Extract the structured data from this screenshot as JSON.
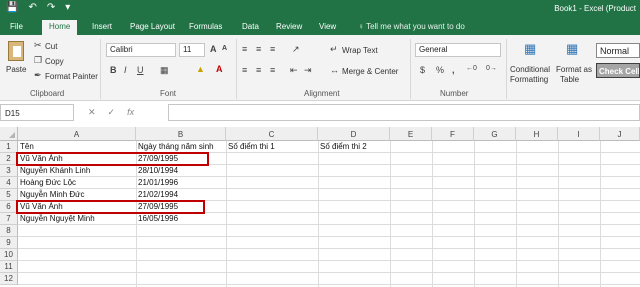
{
  "titlebar": {
    "qat": [
      "save-icon",
      "undo-icon",
      "redo-icon",
      "customize-icon"
    ],
    "title": "Book1 - Excel (Product"
  },
  "tabs": [
    "File",
    "Home",
    "Insert",
    "Page Layout",
    "Formulas",
    "Data",
    "Review",
    "View"
  ],
  "tell_me": "♀ Tell me what you want to do",
  "ribbon": {
    "clipboard": {
      "paste": "Paste",
      "cut": "Cut",
      "copy": "Copy",
      "format_painter": "Format Painter",
      "label": "Clipboard"
    },
    "font": {
      "name": "Calibri",
      "size": "11",
      "bold": "B",
      "italic": "I",
      "underline": "U",
      "label": "Font",
      "grow": "A",
      "shrink": "A"
    },
    "alignment": {
      "wrap": "Wrap Text",
      "merge": "Merge & Center",
      "label": "Alignment"
    },
    "number": {
      "format": "General",
      "currency": "$",
      "percent": "%",
      "comma": ",",
      "label": "Number"
    },
    "styles": {
      "conditional": "Conditional",
      "conditional2": "Formatting",
      "format_as": "Format as",
      "table": "Table",
      "normal": "Normal",
      "check": "Check Cell"
    }
  },
  "formula_bar": {
    "cell_ref": "D15",
    "fx": "fx",
    "value": ""
  },
  "columns": [
    "A",
    "B",
    "C",
    "D",
    "E",
    "F",
    "G",
    "H",
    "I",
    "J"
  ],
  "rows": [
    "1",
    "2",
    "3",
    "4",
    "5",
    "6",
    "7",
    "8",
    "9",
    "10",
    "11",
    "12"
  ],
  "sheet": {
    "headers": {
      "a": "Tên",
      "b": "Ngày tháng năm sinh",
      "c": "Số điểm thi 1",
      "d": "Số điểm thi 2"
    },
    "data": [
      {
        "name": "Vũ Văn Ánh",
        "dob": "27/09/1995"
      },
      {
        "name": "Nguyễn Khánh Linh",
        "dob": "28/10/1994"
      },
      {
        "name": "Hoàng Đức Lộc",
        "dob": "21/01/1996"
      },
      {
        "name": "Nguyễn Minh Đức",
        "dob": "21/02/1994"
      },
      {
        "name": "Vũ Văn Ánh",
        "dob": "27/09/1995"
      },
      {
        "name": "Nguyễn Nguyệt Minh",
        "dob": "16/05/1996"
      }
    ]
  },
  "accent": "#217346",
  "highlight": "#c00000"
}
